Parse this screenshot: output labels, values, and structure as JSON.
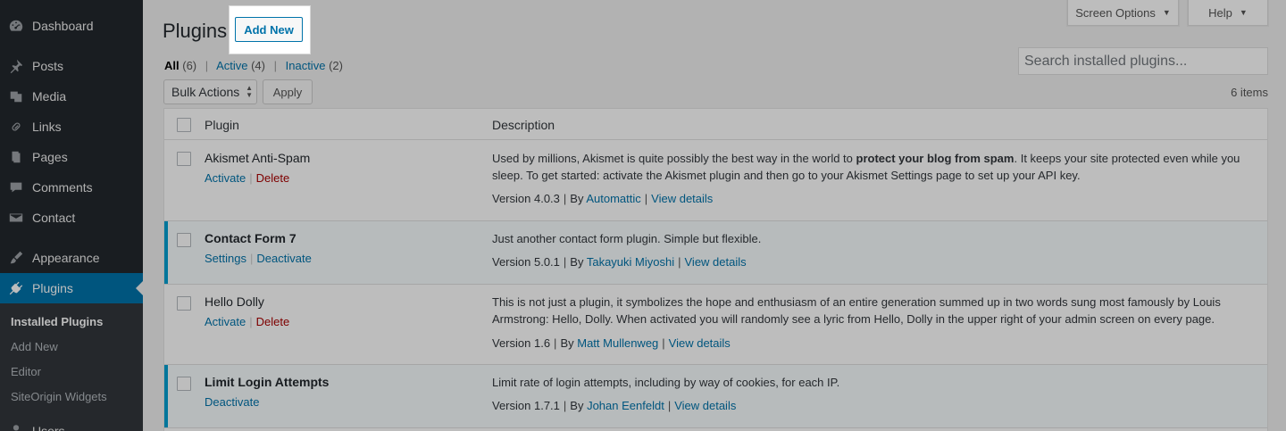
{
  "sidebar": {
    "menu": [
      {
        "label": "Dashboard",
        "icon": "dashboard-icon"
      },
      {
        "label": "Posts",
        "icon": "pin-icon"
      },
      {
        "label": "Media",
        "icon": "media-icon"
      },
      {
        "label": "Links",
        "icon": "link-icon"
      },
      {
        "label": "Pages",
        "icon": "pages-icon"
      },
      {
        "label": "Comments",
        "icon": "comment-icon"
      },
      {
        "label": "Contact",
        "icon": "mail-icon"
      },
      {
        "label": "Appearance",
        "icon": "paintbrush-icon"
      },
      {
        "label": "Plugins",
        "icon": "plugin-icon"
      },
      {
        "label": "Users",
        "icon": "user-icon"
      }
    ],
    "submenu": [
      "Installed Plugins",
      "Add New",
      "Editor",
      "SiteOrigin Widgets"
    ]
  },
  "header": {
    "title": "Plugins",
    "add_new": "Add New",
    "screen_options": "Screen Options",
    "help": "Help"
  },
  "filters": {
    "all": "All",
    "all_count": "(6)",
    "active": "Active",
    "active_count": "(4)",
    "inactive": "Inactive",
    "inactive_count": "(2)"
  },
  "search": {
    "placeholder": "Search installed plugins..."
  },
  "bulk": {
    "label": "Bulk Actions",
    "apply": "Apply",
    "count": "6 items"
  },
  "table": {
    "col_plugin": "Plugin",
    "col_description": "Description",
    "rows": [
      {
        "name": "Akismet Anti-Spam",
        "action1": "Activate",
        "action2": "Delete",
        "desc_pre": "Used by millions, Akismet is quite possibly the best way in the world to ",
        "desc_bold": "protect your blog from spam",
        "desc_post": ". It keeps your site protected even while you sleep. To get started: activate the Akismet plugin and then go to your Akismet Settings page to set up your API key.",
        "version": "Version 4.0.3",
        "by": "By",
        "author": "Automattic",
        "details": "View details"
      },
      {
        "name": "Contact Form 7",
        "action1": "Settings",
        "action2": "Deactivate",
        "desc_pre": "Just another contact form plugin. Simple but flexible.",
        "version": "Version 5.0.1",
        "by": "By",
        "author": "Takayuki Miyoshi",
        "details": "View details"
      },
      {
        "name": "Hello Dolly",
        "action1": "Activate",
        "action2": "Delete",
        "desc_pre": "This is not just a plugin, it symbolizes the hope and enthusiasm of an entire generation summed up in two words sung most famously by Louis Armstrong: Hello, Dolly. When activated you will randomly see a lyric from Hello, Dolly in the upper right of your admin screen on every page.",
        "version": "Version 1.6",
        "by": "By",
        "author": "Matt Mullenweg",
        "details": "View details"
      },
      {
        "name": "Limit Login Attempts",
        "action1": "Deactivate",
        "desc_pre": "Limit rate of login attempts, including by way of cookies, for each IP.",
        "version": "Version 1.7.1",
        "by": "By",
        "author": "Johan Eenfeldt",
        "details": "View details"
      }
    ]
  }
}
